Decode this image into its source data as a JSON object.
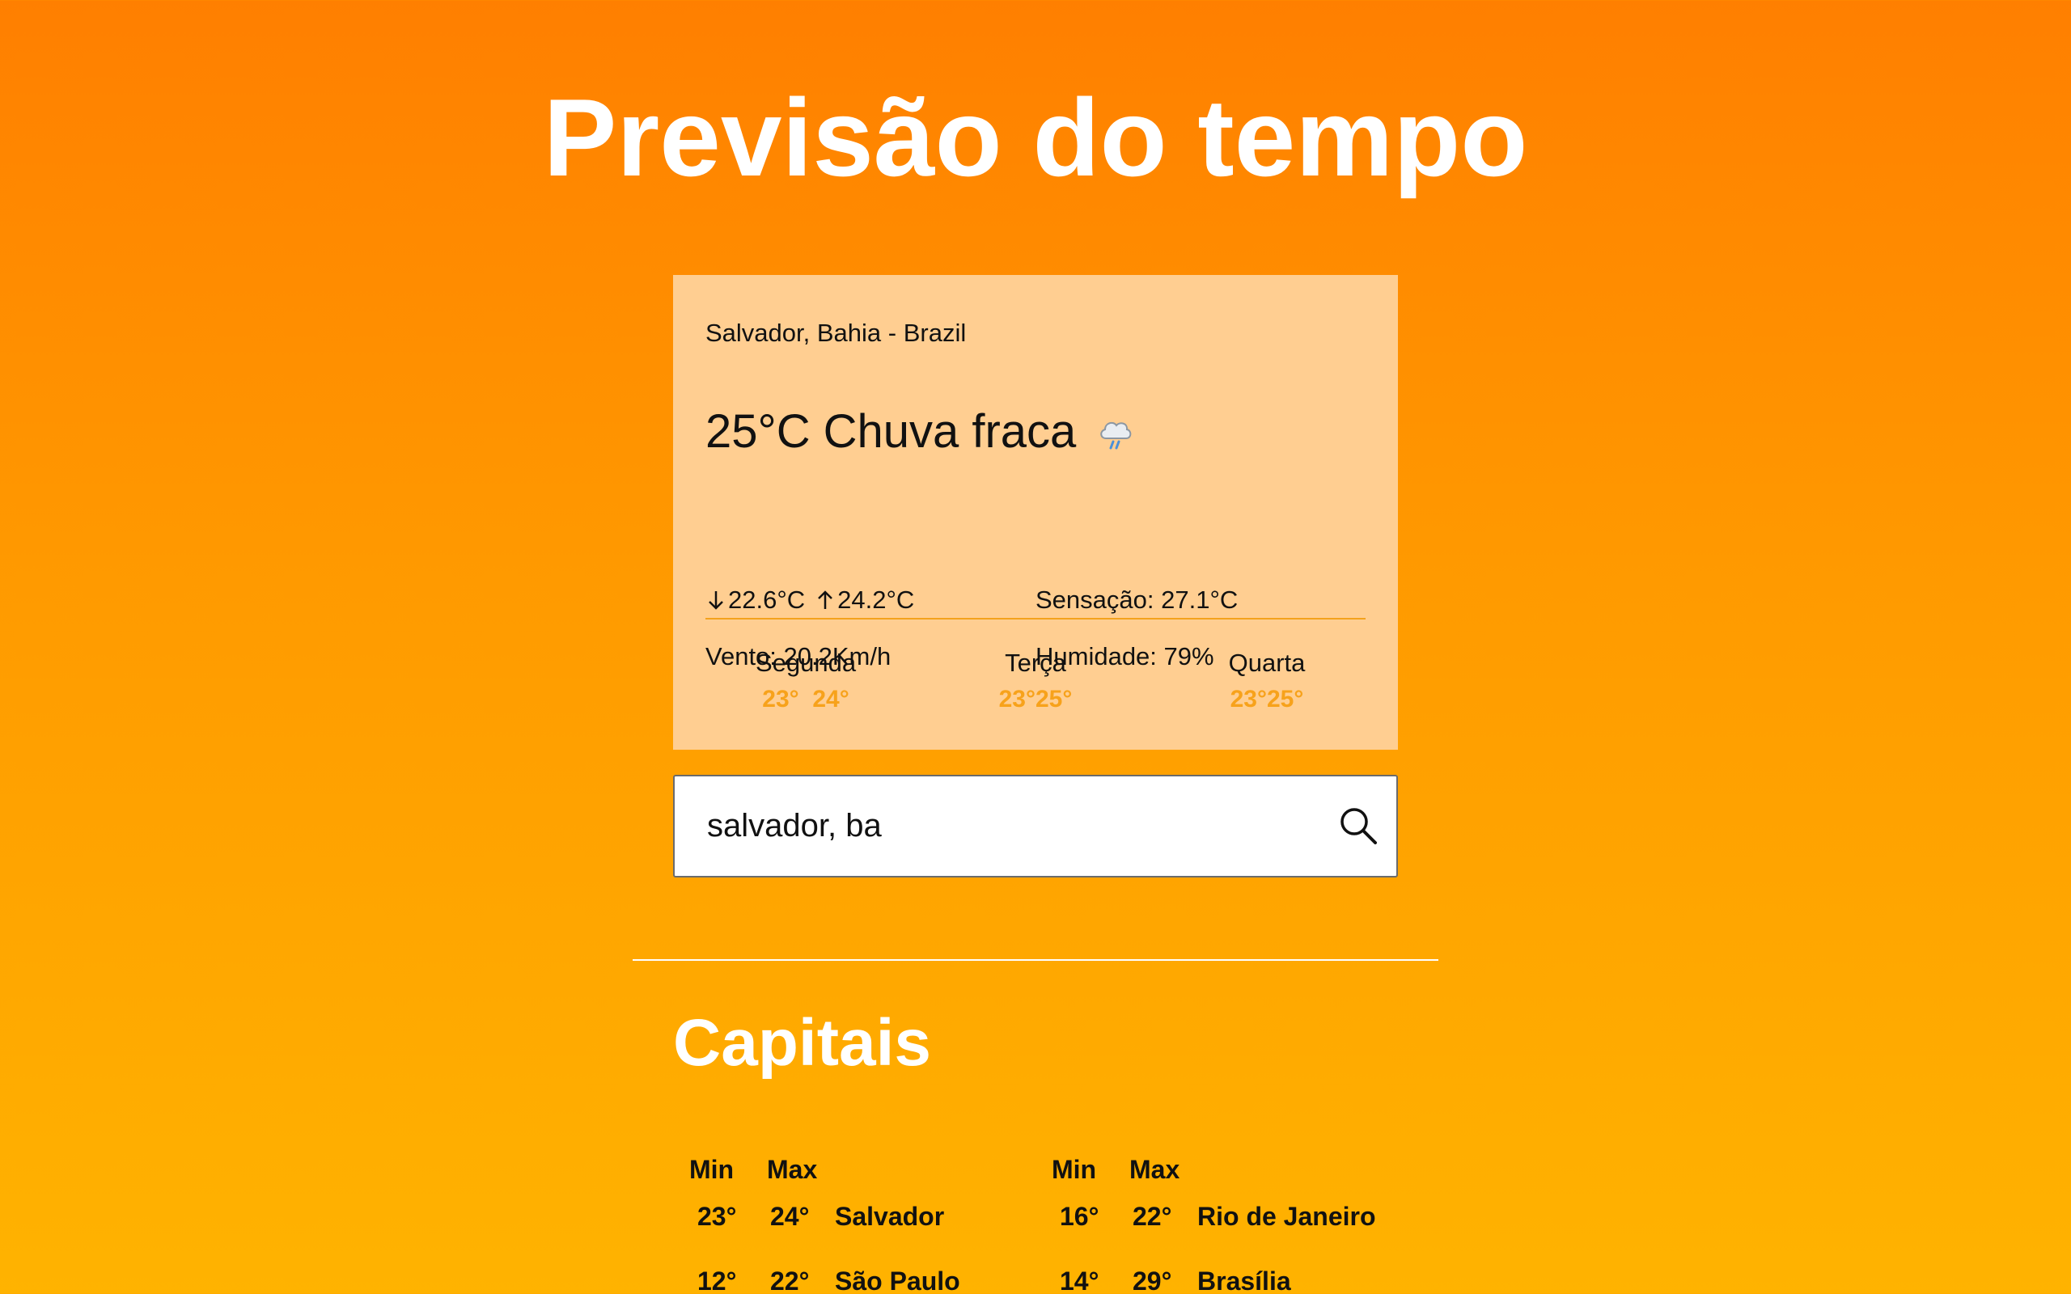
{
  "header": {
    "title": "Previsão do tempo"
  },
  "weather": {
    "location": "Salvador, Bahia - Brazil",
    "temperature": "25°C",
    "condition": "Chuva fraca",
    "condition_icon": "rain-cloud-icon",
    "min_temp": "22.6°C",
    "max_temp": "24.2°C",
    "feels_like": "Sensação: 27.1°C",
    "wind": "Vento: 20.2Km/h",
    "humidity": "Humidade: 79%",
    "forecast": [
      {
        "day": "Segunda",
        "temps": "23°  24°"
      },
      {
        "day": "Terça",
        "temps": "23°25°"
      },
      {
        "day": "Quarta",
        "temps": "23°25°"
      }
    ]
  },
  "search": {
    "value": "salvador, ba",
    "icon": "search-icon"
  },
  "capitals": {
    "title": "Capitais",
    "headers": {
      "min": "Min",
      "max": "Max"
    },
    "rows": [
      {
        "min": "23°",
        "max": "24°",
        "city": "Salvador"
      },
      {
        "min": "16°",
        "max": "22°",
        "city": "Rio de Janeiro"
      },
      {
        "min": "12°",
        "max": "22°",
        "city": "São Paulo"
      },
      {
        "min": "14°",
        "max": "29°",
        "city": "Brasília"
      }
    ]
  },
  "colors": {
    "background_top": "#ff7f00",
    "background_bottom": "#ffb300",
    "card": "#ffce91",
    "accent": "#f7a21b"
  }
}
